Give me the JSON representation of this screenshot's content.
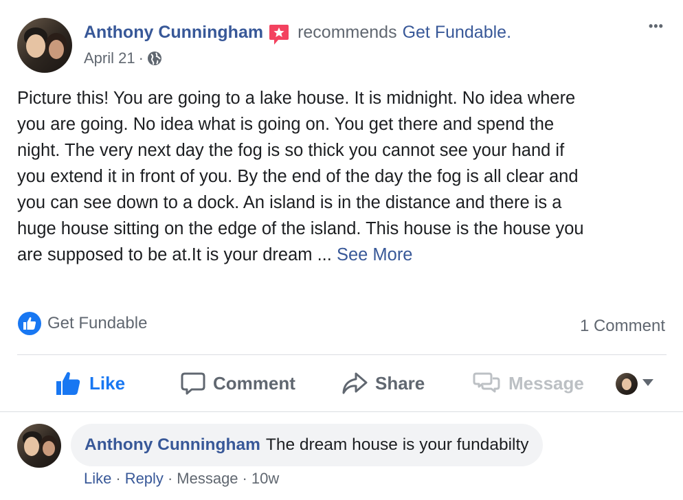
{
  "post": {
    "author_name": "Anthony Cunningham",
    "recommends_text": "recommends",
    "page_name": "Get Fundable.",
    "date": "April 21",
    "date_sep": "·",
    "more_label": "•••",
    "body_lines": [
      "Picture this! You are going to a lake house. It is midnight. No idea where",
      "you are going. No idea what is going on. You get there and spend the",
      "night. The very next day the fog is so thick you cannot see your hand if",
      "you extend it in front of you. By the end of the day the fog is all clear and",
      "you can see down to a dock. An island is in the distance and there is a",
      "huge house sitting on the edge of the island. This house is the house you"
    ],
    "body_last_line": "are supposed to be at.It is your dream ...",
    "see_more": "See More"
  },
  "reactions": {
    "liker": "Get Fundable",
    "comment_count": "1 Comment"
  },
  "actions": {
    "like": "Like",
    "comment": "Comment",
    "share": "Share",
    "message": "Message"
  },
  "comment": {
    "author_name": "Anthony Cunningham",
    "text": "The dream house is your fundabilty",
    "like": "Like",
    "reply": "Reply",
    "message": "Message",
    "age": "10w",
    "dot": "·"
  },
  "colors": {
    "link": "#385898",
    "like_blue": "#1877f2",
    "recommend_red": "#f3425f",
    "muted": "#606770",
    "disabled": "#bcc0c4",
    "bubble": "#f2f3f5"
  }
}
